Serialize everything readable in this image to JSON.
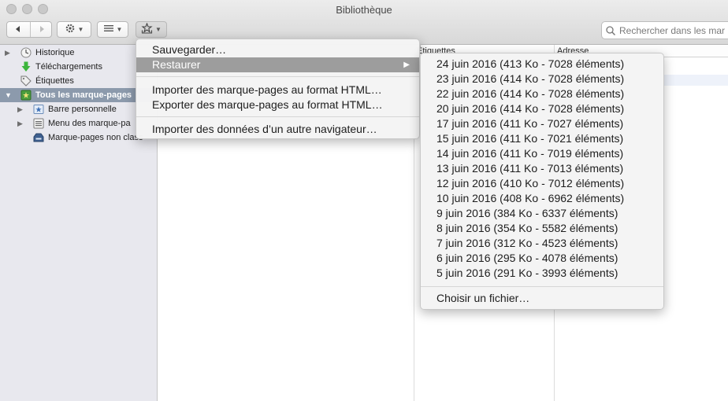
{
  "window": {
    "title": "Bibliothèque"
  },
  "toolbar": {
    "back_icon": "back-arrow-icon",
    "forward_icon": "forward-arrow-icon",
    "organize_icon": "gear-icon",
    "views_icon": "list-icon",
    "import_backup_icon": "star-tray-icon",
    "search_placeholder": "Rechercher dans les mar"
  },
  "sidebar": {
    "items": [
      {
        "label": "Historique",
        "icon": "clock-icon",
        "expandable": true
      },
      {
        "label": "Téléchargements",
        "icon": "download-arrow-icon",
        "expandable": false
      },
      {
        "label": "Étiquettes",
        "icon": "tag-icon",
        "expandable": false
      },
      {
        "label": "Tous les marque-pages",
        "icon": "bookmarks-star-icon",
        "expandable": true,
        "selected": true
      },
      {
        "label": "Barre personnelle",
        "icon": "star-folder-icon",
        "expandable": true
      },
      {
        "label": "Menu des marque-pa",
        "icon": "menu-folder-icon",
        "expandable": true
      },
      {
        "label": "Marque-pages non class",
        "icon": "unsorted-folder-icon",
        "expandable": false
      }
    ]
  },
  "columns": [
    "Étiquettes",
    "Adresse"
  ],
  "menu": {
    "items": [
      {
        "label": "Sauvegarder…"
      },
      {
        "label": "Restaurer",
        "has_submenu": true,
        "highlighted": true
      },
      {
        "label": "Importer des marque-pages au format HTML…"
      },
      {
        "label": "Exporter des marque-pages au format HTML…"
      },
      {
        "label": "Importer des données d’un autre navigateur…"
      }
    ]
  },
  "submenu": {
    "backups": [
      "24 juin 2016 (413 Ko - 7028 éléments)",
      "23 juin 2016 (414 Ko - 7028 éléments)",
      "22 juin 2016 (414 Ko - 7028 éléments)",
      "20 juin 2016 (414 Ko - 7028 éléments)",
      "17 juin 2016 (411 Ko - 7027 éléments)",
      "15 juin 2016 (411 Ko - 7021 éléments)",
      "14 juin 2016 (411 Ko - 7019 éléments)",
      "13 juin 2016 (411 Ko - 7013 éléments)",
      "12 juin 2016 (410 Ko - 7012 éléments)",
      "10 juin 2016 (408 Ko - 6962 éléments)",
      "9 juin 2016 (384 Ko - 6337 éléments)",
      "8 juin 2016 (354 Ko - 5582 éléments)",
      "7 juin 2016 (312 Ko - 4523 éléments)",
      "6 juin 2016 (295 Ko - 4078 éléments)",
      "5 juin 2016 (291 Ko - 3993 éléments)"
    ],
    "choose_file": "Choisir un fichier…"
  }
}
